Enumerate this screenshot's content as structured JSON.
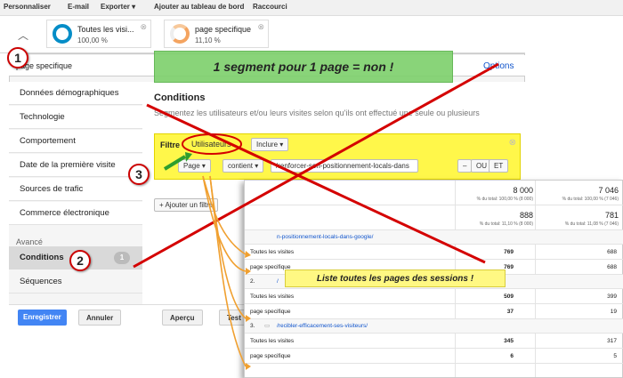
{
  "topbar": {
    "items": [
      "Personnaliser",
      "E-mail",
      "Exporter ▾",
      "Ajouter au tableau de bord",
      "Raccourci"
    ]
  },
  "segments": [
    {
      "name": "Toutes les visi...",
      "pct": "100,00 %",
      "color": "#058dc7"
    },
    {
      "name": "page specifique",
      "pct": "11,10 %",
      "color": "#f4a460"
    }
  ],
  "search": {
    "value": "page specifique",
    "options": "Options"
  },
  "banner": "1 segment pour 1 page = non !",
  "nav": {
    "items": [
      "Données démographiques",
      "Technologie",
      "Comportement",
      "Date de la première visite",
      "Sources de trafic",
      "Commerce électronique"
    ],
    "section": "Avancé",
    "conditions": "Conditions",
    "conditions_count": "1",
    "sequences": "Séquences"
  },
  "conditions": {
    "title": "Conditions",
    "desc": "Segmentez les utilisateurs et/ou leurs visites selon qu'ils ont effectué une seule ou plusieurs",
    "filtre": "Filtre",
    "users": "Utilisateurs",
    "include": "Inclure",
    "dim": "Page",
    "op": "contient",
    "value": "/renforcer-son-positionnement-locals-dans",
    "minus": "–",
    "ou": "OU",
    "et": "ET",
    "add_filter": "+ Ajouter un filtre"
  },
  "buttons": {
    "save": "Enregistrer",
    "cancel": "Annuler",
    "preview": "Aperçu",
    "test": "Test"
  },
  "badges": [
    "1",
    "2",
    "3"
  ],
  "note": "Liste toutes les pages des sessions !",
  "table": {
    "h1": {
      "v1": "8 000",
      "s1": "% du total: 100,00 % (8 000)",
      "v2": "7 046",
      "s2": "% du total: 100,00 % (7 046)"
    },
    "h2": {
      "v1": "888",
      "s1": "% du total: 11,10 % (8 000)",
      "v2": "781",
      "s2": "% du total: 11,08 % (7 046)"
    },
    "url1": "n-positionnement-locals-dans-google/",
    "url2": "/",
    "url3": "/recibler-efficacement-ses-visiteurs/",
    "rows": [
      {
        "label": "Toutes les visites",
        "a": "769",
        "b": "688"
      },
      {
        "label": "page specifique",
        "a": "769",
        "b": "688"
      },
      {
        "label": "Toutes les visites",
        "a": "509",
        "b": "399"
      },
      {
        "label": "page specifique",
        "a": "37",
        "b": "19"
      },
      {
        "label": "Toutes les visites",
        "a": "345",
        "b": "317"
      },
      {
        "label": "page specifique",
        "a": "6",
        "b": "5"
      }
    ],
    "idx2": "2.",
    "idx3": "3."
  },
  "colors": {
    "accent": "#4285f4",
    "red": "#d40000",
    "orange": "#f0a030",
    "green": "#2e9e2e",
    "banner": "#7fd16e",
    "note": "#fff883"
  }
}
